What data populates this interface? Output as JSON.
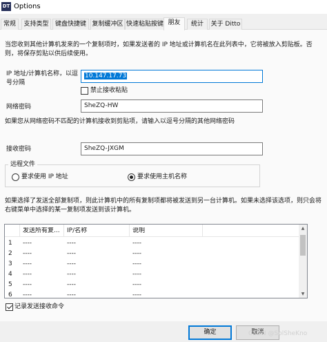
{
  "window": {
    "title": "Options",
    "icon_text": "DT"
  },
  "tabs": [
    "常规",
    "支持类型",
    "键盘快捷键",
    "复制缓冲区",
    "快速粘贴按键",
    "朋友",
    "统计",
    "关于 Ditto"
  ],
  "intro": {
    "line1": "当您收到其他计算机发来的一个复制项时，如果发送者的 IP 地址或计算机名在此列表中，它将被放入剪贴板。否",
    "line2": "则，将保存剪贴以供后续使用。"
  },
  "ip_field": {
    "label_line1": "IP 地址/计算机名称，以逗",
    "label_line2": "号分隔",
    "value": "10.147.17.73"
  },
  "disable_receive": {
    "label": "禁止接收粘贴",
    "checked": false
  },
  "network_password": {
    "label": "网络密码",
    "value": "SheZQ-HW"
  },
  "other_passwords_hint": "如果您从网络密码不匹配的计算机接收到剪贴项，请输入以逗号分隔的其他网络密码",
  "receive_password": {
    "label": "接收密码",
    "value": "SheZQ-JXGM"
  },
  "remote_file": {
    "group_label": "远程文件",
    "option_ip": "要求使用 IP 地址",
    "option_hostname": "要求使用主机名称",
    "selected": "hostname"
  },
  "send_all": {
    "line1": "如果选择了发送全部复制项，则此计算机中的所有复制项都将被发送到另一台计算机。如果未选择该选项，则只会将",
    "line2": "右键菜单中选择的某一复制项发送到该计算机。"
  },
  "table": {
    "columns": [
      "",
      "发送所有复...",
      "IP/名称",
      "说明"
    ],
    "rows": [
      [
        "1",
        "----",
        "----",
        "----"
      ],
      [
        "2",
        "----",
        "----",
        "----"
      ],
      [
        "3",
        "----",
        "----",
        "----"
      ],
      [
        "4",
        "----",
        "----",
        "----"
      ],
      [
        "5",
        "----",
        "----",
        "----"
      ],
      [
        "6",
        "----",
        "----",
        "----"
      ]
    ]
  },
  "log_send_receive": {
    "label": "记录发送接收命令",
    "checked": true
  },
  "buttons": {
    "ok": "确定",
    "cancel": "取消"
  },
  "watermark": "CSDN @SolSheKno"
}
